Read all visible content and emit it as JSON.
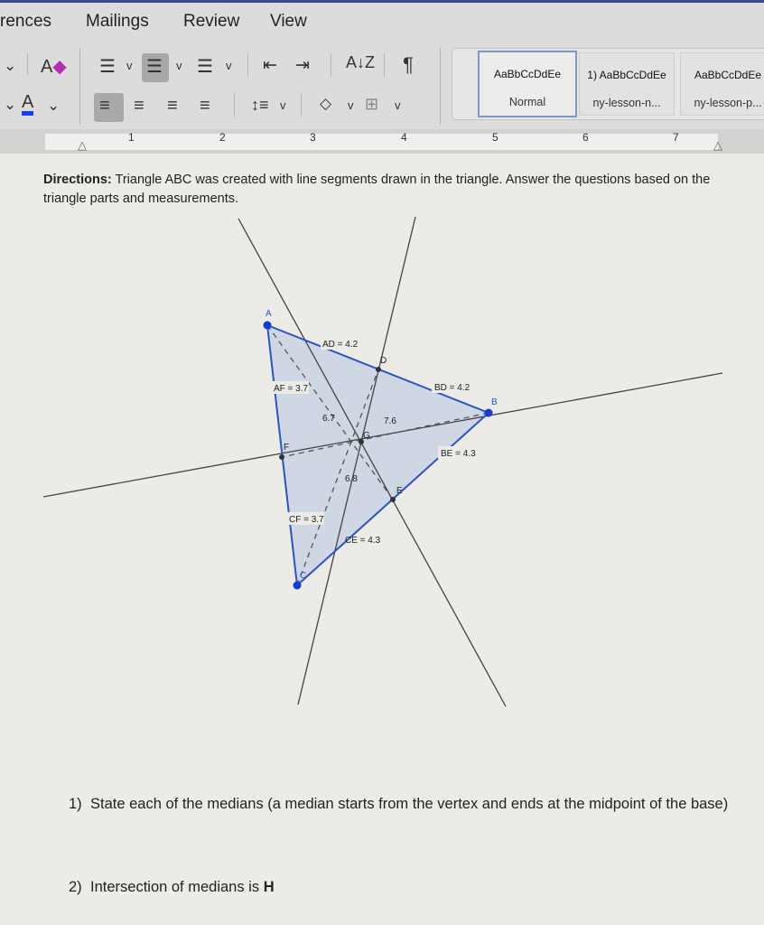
{
  "ribbon": {
    "tabs": [
      "rences",
      "Mailings",
      "Review",
      "View"
    ],
    "sort_icon_label": "A↓Z",
    "pilcrow": "¶",
    "styles": [
      {
        "preview": "AaBbCcDdEe",
        "name": "Normal",
        "selected": true
      },
      {
        "preview": "1) AaBbCcDdEe",
        "name": "ny-lesson-n..."
      },
      {
        "preview": "AaBbCcDdEe",
        "name": "ny-lesson-p..."
      }
    ],
    "font_color": "#1a3cff"
  },
  "ruler": {
    "numbers": [
      "1",
      "2",
      "3",
      "4",
      "5",
      "6",
      "7"
    ]
  },
  "document": {
    "directions_bold": "Directions:",
    "directions_text": " Triangle ABC was created with line segments drawn in the triangle.  Answer the questions based on the triangle parts and measurements.",
    "diagram": {
      "vertices": {
        "A": "A",
        "B": "B",
        "C": "C",
        "D": "D",
        "E": "E",
        "F": "F",
        "G": "G"
      },
      "measurements": {
        "AD": "AD = 4.2",
        "BD": "BD = 4.2",
        "AF": "AF = 3.7",
        "CF": "CF = 3.7",
        "BE": "BE = 4.3",
        "CE": "CE = 4.3",
        "AG_seg": "6.7",
        "BG_seg": "7.6",
        "CG_seg": "6.8"
      },
      "triangle_color": "#2a55c0",
      "fill_color": "#c9d3e2"
    },
    "q1_num": "1)",
    "q1": "State each of the medians (a median starts from the vertex and ends at the midpoint of the base)",
    "q2_num": "2)",
    "q2_text": "Intersection of medians is ",
    "q2_bold": "H"
  }
}
